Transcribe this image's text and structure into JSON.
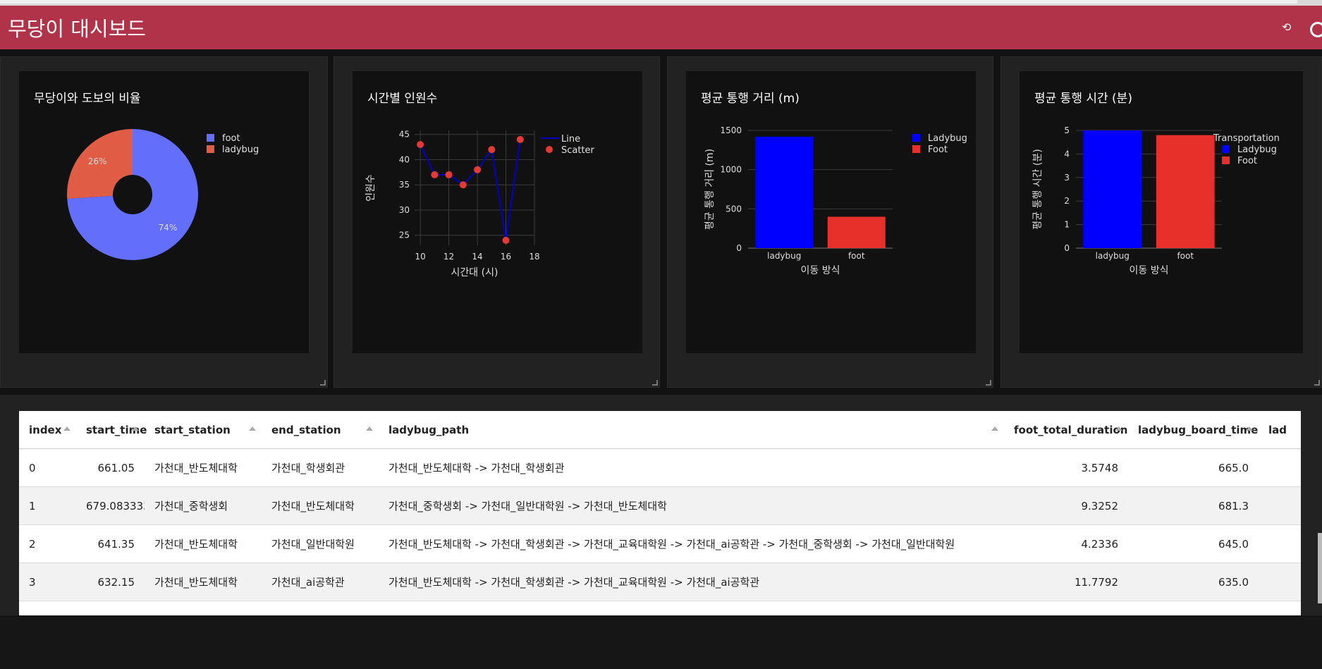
{
  "app": {
    "title": "무당이 대시보드"
  },
  "charts": {
    "pie": {
      "title": "무당이와 도보의 비율"
    },
    "line": {
      "title": "시간별 인원수"
    },
    "dist": {
      "title": "평균 통행 거리 (m)"
    },
    "time": {
      "title": "평균 통행 시간 (분)"
    }
  },
  "chart_data": [
    {
      "type": "pie",
      "title": "무당이와 도보의 비율",
      "labels": [
        "foot",
        "ladybug"
      ],
      "values": [
        74,
        26
      ],
      "value_labels": [
        "74%",
        "26%"
      ],
      "hole": true,
      "colors": [
        "#636efa",
        "#e05c44"
      ],
      "legend": "top-right"
    },
    {
      "type": "line",
      "title": "시간별 인원수",
      "xlabel": "시간대 (시)",
      "ylabel": "인원수",
      "x": [
        10,
        11,
        12,
        13,
        14,
        15,
        16,
        17
      ],
      "series": [
        {
          "name": "Line",
          "values": [
            43,
            37,
            37,
            35,
            38,
            42,
            24,
            44
          ],
          "color": "#0000cc"
        },
        {
          "name": "Scatter",
          "values": [
            43,
            37,
            37,
            35,
            38,
            42,
            24,
            44
          ],
          "color": "#e53935"
        }
      ],
      "xlim": [
        9.6,
        18
      ],
      "ylim": [
        23,
        45.8
      ],
      "xticks": [
        "10",
        "12",
        "14",
        "16",
        "18"
      ],
      "yticks": [
        "25",
        "30",
        "35",
        "40",
        "45"
      ],
      "grid": true,
      "legend": "top-right"
    },
    {
      "type": "bar",
      "title": "평균 통행 거리 (m)",
      "xlabel": "이동 방식",
      "ylabel": "평균 통행 거리 (m)",
      "categories": [
        "ladybug",
        "foot"
      ],
      "series": [
        {
          "name": "Ladybug",
          "values": [
            1420,
            null
          ],
          "color": "#0000ff"
        },
        {
          "name": "Foot",
          "values": [
            null,
            400
          ],
          "color": "#e8302a"
        }
      ],
      "ylim": [
        0,
        1500
      ],
      "yticks": [
        "0",
        "500",
        "1000",
        "1500"
      ],
      "legend": "top-right"
    },
    {
      "type": "bar",
      "title": "평균 통행 시간 (분)",
      "xlabel": "이동 방식",
      "ylabel": "평균 통행 시간 (분)",
      "legend_title": "Transportation",
      "categories": [
        "ladybug",
        "foot"
      ],
      "series": [
        {
          "name": "Ladybug",
          "values": [
            5.0,
            null
          ],
          "color": "#0000ff"
        },
        {
          "name": "Foot",
          "values": [
            null,
            4.8
          ],
          "color": "#e8302a"
        }
      ],
      "ylim": [
        0,
        5
      ],
      "yticks": [
        "0",
        "1",
        "2",
        "3",
        "4",
        "5"
      ],
      "legend": "top-right"
    }
  ],
  "table": {
    "columns": [
      "index",
      "start_time",
      "start_station",
      "end_station",
      "ladybug_path",
      "foot_total_duration",
      "ladybug_board_time",
      "lad"
    ],
    "rows": [
      [
        "0",
        "661.05",
        "가천대_반도체대학",
        "가천대_학생회관",
        "가천대_반도체대학 -> 가천대_학생회관",
        "3.5748",
        "665.0",
        ""
      ],
      [
        "1",
        "679.083333",
        "가천대_중학생회",
        "가천대_반도체대학",
        "가천대_중학생회 -> 가천대_일반대학원 -> 가천대_반도체대학",
        "9.3252",
        "681.3",
        ""
      ],
      [
        "2",
        "641.35",
        "가천대_반도체대학",
        "가천대_일반대학원",
        "가천대_반도체대학 -> 가천대_학생회관 -> 가천대_교육대학원 -> 가천대_ai공학관 -> 가천대_중학생회 -> 가천대_일반대학원",
        "4.2336",
        "645.0",
        ""
      ],
      [
        "3",
        "632.15",
        "가천대_반도체대학",
        "가천대_ai공학관",
        "가천대_반도체대학 -> 가천대_학생회관 -> 가천대_교육대학원 -> 가천대_ai공학관",
        "11.7792",
        "635.0",
        ""
      ]
    ]
  }
}
